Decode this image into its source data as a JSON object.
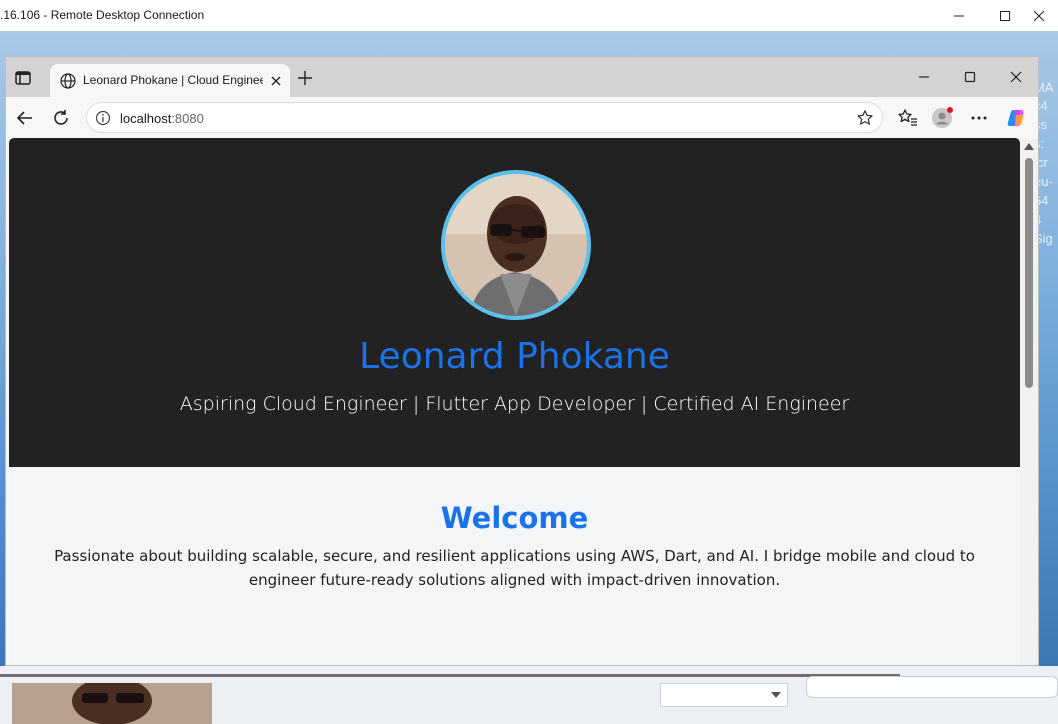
{
  "rdp": {
    "title": ".16.106 - Remote Desktop Connection",
    "background_text": [
      "MA",
      "c4",
      "ss",
      "s:",
      "icr",
      "eu-",
      "64",
      "4",
      "Sig"
    ]
  },
  "browser": {
    "tab_title": "Leonard Phokane | Cloud Engineer",
    "url_host": "localhost",
    "url_port": ":8080"
  },
  "page": {
    "name": "Leonard Phokane",
    "subtitle": "Aspiring Cloud Engineer | Flutter App Developer | Certified AI Engineer",
    "welcome_title": "Welcome",
    "welcome_text": "Passionate about building scalable, secure, and resilient applications using AWS, Dart, and AI. I bridge mobile and cloud to engineer future-ready solutions aligned with impact-driven innovation."
  },
  "colors": {
    "accent": "#1a73e8",
    "hero_bg": "#222222",
    "avatar_ring": "#5bc0eb",
    "page_bg": "#f4f5f7"
  },
  "icons": [
    "tab-actions-icon",
    "globe-icon",
    "close-icon",
    "plus-icon",
    "minimize-icon",
    "maximize-icon",
    "back-arrow-icon",
    "refresh-icon",
    "info-icon",
    "star-icon",
    "favorites-icon",
    "profile-icon",
    "more-icon",
    "copilot-icon",
    "scroll-up-icon",
    "chevron-down-icon"
  ]
}
